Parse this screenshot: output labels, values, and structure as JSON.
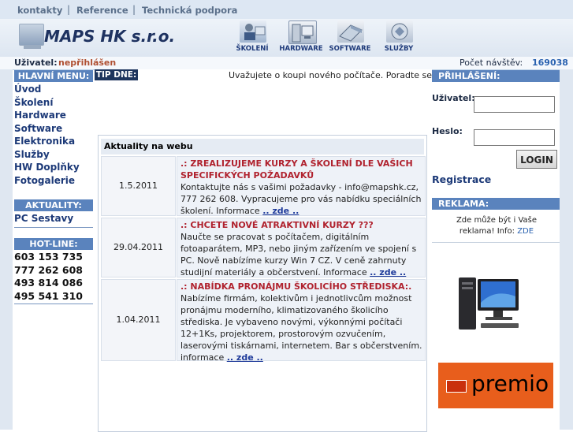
{
  "toplinks": [
    "kontakty",
    "Reference",
    "Technická podpora"
  ],
  "separator": "|",
  "header": {
    "logo": "MAPS HK s.r.o.",
    "nav": [
      {
        "label": "ŠKOLENÍ",
        "icon": "training-icon"
      },
      {
        "label": "HARDWARE",
        "icon": "hardware-icon"
      },
      {
        "label": "SOFTWARE",
        "icon": "software-icon"
      },
      {
        "label": "SLUŽBY",
        "icon": "services-icon"
      }
    ]
  },
  "userbar": {
    "user_label": "Uživatel:",
    "user_value": "nepřihlášen",
    "visits_label": "Počet návštěv:",
    "visits_value": "169038"
  },
  "left": {
    "menu_title": "HLAVNÍ MENU:",
    "menu": [
      "Úvod",
      "Školení",
      "Hardware",
      "Software",
      "Elektronika",
      "Služby",
      "HW Doplňky",
      "Fotogalerie"
    ],
    "news_title": "AKTUALITY:",
    "news_items": [
      "PC Sestavy"
    ],
    "hotline_title": "HOT-LINE:",
    "phones": [
      "603 153 735",
      "777 262 608",
      "493 814 086",
      "495 541 310"
    ]
  },
  "center": {
    "tip_label": "TIP DNE:",
    "tip_text": "Uvažujete o koupi nového počítače. Poradte se s n",
    "news_title": "Aktuality na webu",
    "news": [
      {
        "date": "1.5.2011",
        "headline": ".: ZREALIZUJEME KURZY A ŠKOLENÍ DLE VAŠICH SPECIFICKÝCH POŽADAVKŮ",
        "text": "Kontaktujte nás s vašimi požadavky - info@mapshk.cz, 777 262 608. Vypracujeme pro vás nabídku speciálních školení. Informace",
        "more": ".. zde .."
      },
      {
        "date": "29.04.2011",
        "headline": ".: CHCETE NOVÉ ATRAKTIVNÍ KURZY ???",
        "text": "Naučte se pracovat s počítačem, digitálním fotoaparátem, MP3, nebo jiným zařízením ve spojení s PC. Nově nabízíme kurzy Win 7 CZ. V ceně zahrnuty studijní materiály a občerstvení. Informace",
        "more": ".. zde .."
      },
      {
        "date": "1.04.2011",
        "headline": ".: NABÍDKA PRONÁJMU ŠKOLICÍHO STŘEDISKA:.",
        "text": "Nabízíme firmám, kolektivům i jednotlivcům možnost pronájmu moderního, klimatizovaného školicího střediska. Je vybaveno novými, výkonnými počítači 12+1Ks, projektorem, prostorovým ozvučením, laserovými tiskárnami, internetem. Bar s občerstvením. informace",
        "more": ".. zde .."
      }
    ]
  },
  "right": {
    "login_title": "PŘIHLÁŠENÍ:",
    "user_label": "Uživatel:",
    "pass_label": "Heslo:",
    "login_button": "LOGIN",
    "register": "Registrace",
    "ad_title": "REKLAMA:",
    "ad_text": "Zde může být i Vaše reklama! Info:",
    "ad_link": "ZDE",
    "banner": "premio"
  }
}
